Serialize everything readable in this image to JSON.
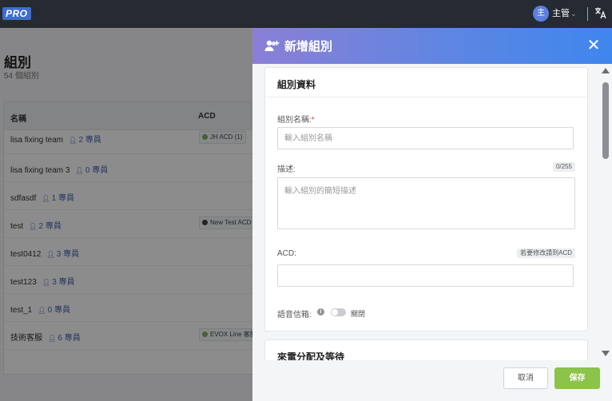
{
  "app": {
    "logo": "PRO"
  },
  "topbar": {
    "avatar_initial": "主",
    "user_name": "主管",
    "chevron": "⌄"
  },
  "background_page": {
    "title": "組別",
    "subtitle": "54 個組別",
    "columns": [
      "名稱",
      "ACD"
    ],
    "rows": [
      {
        "name": "lisa fixing team",
        "members": "2 專員",
        "acd": "JH ACD  (1)",
        "acd_color": "#7ab55c"
      },
      {
        "name": "lisa fixing team 3",
        "members": "0 專員",
        "acd": "",
        "acd_color": ""
      },
      {
        "name": "sdfasdf",
        "members": "1 專員",
        "acd": "",
        "acd_color": ""
      },
      {
        "name": "test",
        "members": "2 專員",
        "acd": "New Test ACD",
        "acd_color": "#444444"
      },
      {
        "name": "test0412",
        "members": "3 專員",
        "acd": "",
        "acd_color": ""
      },
      {
        "name": "test123",
        "members": "3 專員",
        "acd": "",
        "acd_color": ""
      },
      {
        "name": "test_1",
        "members": "0 專員",
        "acd": "",
        "acd_color": ""
      },
      {
        "name": "技術客服",
        "members": "6 專員",
        "acd": "EVOX Line 客服",
        "acd_color": "#7ab55c"
      }
    ]
  },
  "drawer": {
    "title": "新增組別",
    "close_glyph": "✕",
    "section1": {
      "title": "組別資料",
      "name_label": "組別名稱:",
      "required_mark": "*",
      "name_placeholder": "輸入組別名稱",
      "name_value": "",
      "desc_label": "描述:",
      "desc_counter": "0/255",
      "desc_placeholder": "輸入組別的簡短描述",
      "desc_value": "",
      "acd_label": "ACD:",
      "acd_hint": "若要修改請到ACD",
      "acd_value": "",
      "voicemail_label": "語音信箱:",
      "voicemail_info": "i",
      "voicemail_state": "關閉"
    },
    "section2": {
      "title": "來電分配及等待"
    },
    "footer": {
      "cancel_label": "取消",
      "save_label": "保存"
    }
  },
  "colors": {
    "header_start": "#8b7fd6",
    "header_end": "#3f86ee",
    "save": "#8cc34b",
    "topbar": "#252a33"
  }
}
